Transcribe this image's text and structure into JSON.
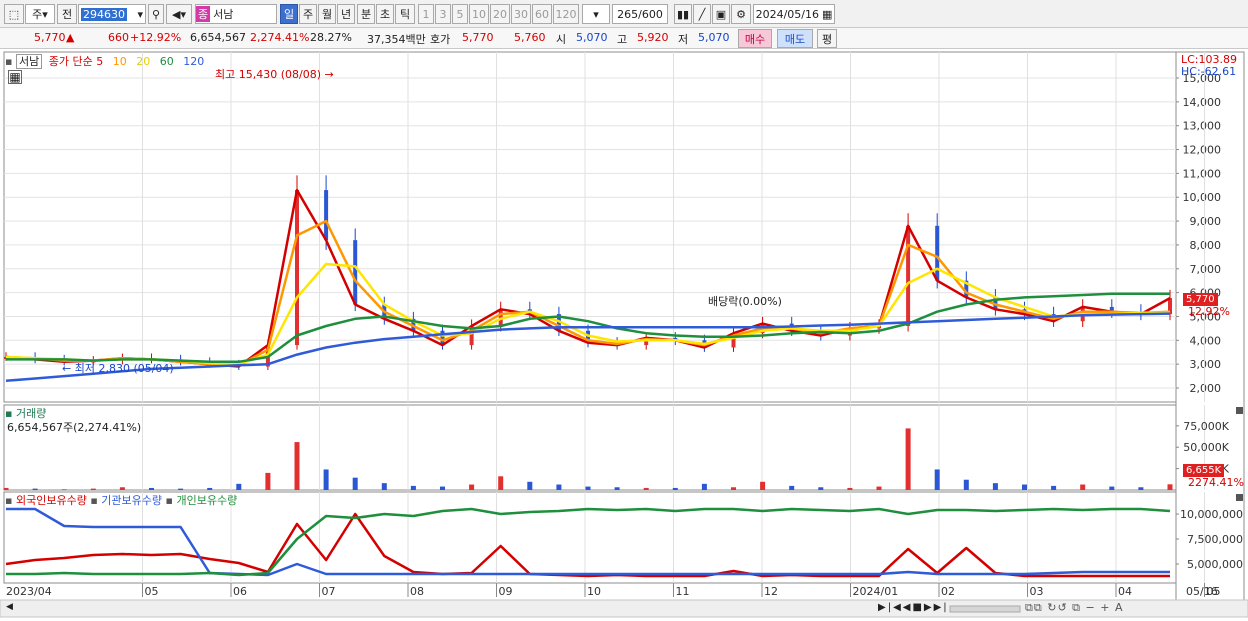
{
  "toolbar": {
    "market": "주",
    "prev": "전",
    "code": "294630",
    "stock_flag": "종",
    "stock_name": "서남",
    "periods": [
      "일",
      "주",
      "월",
      "년",
      "분",
      "초",
      "틱"
    ],
    "active_period": "일",
    "intervals": [
      "1",
      "3",
      "5",
      "10",
      "20",
      "30",
      "60",
      "120"
    ],
    "count": "265",
    "count_total": "/600",
    "date": "2024/05/16"
  },
  "quote": {
    "price": "5,770",
    "change_sign": "▲",
    "change": "660",
    "change_pct": "+12.92%",
    "volume": "6,654,567",
    "volume_ratio": "2,274.41%",
    "turnover": "28.27%",
    "amount": "37,354백만",
    "hoga_label": "호가",
    "ask": "5,770",
    "bid": "5,760",
    "open_label": "시",
    "open": "5,070",
    "high_label": "고",
    "high": "5,920",
    "low_label": "저",
    "low": "5,070",
    "buy_label": "매수",
    "sell_label": "매도",
    "eval_label": "평"
  },
  "price_panel": {
    "name_tag": "서남",
    "ma_title": "종가 단순",
    "ma_periods": [
      "5",
      "10",
      "20",
      "60",
      "120"
    ],
    "ma_colors": [
      "#d40000",
      "#ff9800",
      "#ffe600",
      "#1e8f3c",
      "#2f5bd8"
    ],
    "high_note": "최고 15,430 (08/08)",
    "low_note": "최저 2,830 (05/04)",
    "dividend_note": "배당락(0.00%)",
    "lc": "LC:103.89",
    "hc": "HC:-62.61",
    "price_tag": "5,770",
    "pct_tag": "12.92%",
    "y_ticks": [
      "15,000",
      "14,000",
      "13,000",
      "12,000",
      "11,000",
      "10,000",
      "9,000",
      "8,000",
      "7,000",
      "6,000",
      "5,000",
      "4,000",
      "3,000",
      "2,000"
    ]
  },
  "volume_panel": {
    "title": "거래량",
    "value": "6,654,567주(2,274.41%)",
    "y_ticks": [
      "75,000K",
      "50,000K",
      "25,000K"
    ],
    "tag": "6,655K",
    "tag_pct": "2274.41%"
  },
  "holding_panel": {
    "series_labels": [
      "외국인보유수량",
      "기관보유수량",
      "개인보유수량"
    ],
    "colors": [
      "#d40000",
      "#2f5bd8",
      "#1e8f3c"
    ],
    "y_ticks": [
      "10,000,000",
      "7,500,000",
      "5,000,000"
    ]
  },
  "x_axis": {
    "labels": [
      "2023/04",
      "05",
      "06",
      "07",
      "08",
      "09",
      "10",
      "11",
      "12",
      "2024/01",
      "02",
      "03",
      "04",
      "05"
    ],
    "right_label": "05/16"
  },
  "chart_data": {
    "type": "line",
    "title": "",
    "y_range": [
      2000,
      15430
    ],
    "series": [
      {
        "name": "5",
        "values": [
          3300,
          3200,
          3100,
          3150,
          3250,
          3200,
          3100,
          3000,
          2900,
          3800,
          10300,
          8200,
          5500,
          4900,
          4400,
          3800,
          4600,
          5300,
          5100,
          4400,
          3900,
          3800,
          4100,
          4000,
          3700,
          4300,
          4700,
          4400,
          4200,
          4500,
          4600,
          8800,
          6500,
          5800,
          5300,
          5100,
          4800,
          5400,
          5200,
          5100,
          5770
        ]
      },
      {
        "name": "10",
        "values": [
          3300,
          3250,
          3150,
          3150,
          3250,
          3200,
          3100,
          3000,
          2950,
          3600,
          8400,
          9000,
          6500,
          5200,
          4600,
          4000,
          4400,
          5100,
          5200,
          4600,
          4000,
          3850,
          4050,
          4000,
          3800,
          4200,
          4500,
          4500,
          4300,
          4500,
          4600,
          8000,
          7500,
          6000,
          5500,
          5200,
          4900,
          5200,
          5200,
          5150,
          5200
        ]
      },
      {
        "name": "20",
        "values": [
          3300,
          3250,
          3200,
          3150,
          3200,
          3200,
          3150,
          3050,
          3000,
          3400,
          5800,
          7200,
          7100,
          5500,
          4800,
          4200,
          4300,
          4900,
          5200,
          4800,
          4200,
          3950,
          4000,
          4000,
          3850,
          4100,
          4400,
          4500,
          4400,
          4400,
          4600,
          6400,
          7000,
          6400,
          5800,
          5400,
          5000,
          5100,
          5100,
          5150,
          5150
        ]
      },
      {
        "name": "60",
        "values": [
          3200,
          3200,
          3200,
          3150,
          3200,
          3200,
          3150,
          3100,
          3100,
          3300,
          4200,
          4600,
          4900,
          5000,
          4800,
          4600,
          4500,
          4600,
          4900,
          5000,
          4800,
          4500,
          4300,
          4200,
          4150,
          4150,
          4200,
          4300,
          4350,
          4300,
          4400,
          4700,
          5200,
          5500,
          5700,
          5800,
          5850,
          5900,
          5950,
          5950,
          5950
        ]
      },
      {
        "name": "120",
        "values": [
          2300,
          2400,
          2500,
          2600,
          2700,
          2800,
          2850,
          2900,
          2950,
          3000,
          3400,
          3700,
          3900,
          4050,
          4150,
          4250,
          4350,
          4450,
          4500,
          4550,
          4550,
          4550,
          4550,
          4550,
          4550,
          4550,
          4550,
          4580,
          4620,
          4650,
          4700,
          4750,
          4800,
          4850,
          4900,
          4950,
          5000,
          5050,
          5080,
          5100,
          5120
        ]
      }
    ],
    "volume_k": [
      3,
      2,
      1,
      2,
      4,
      3,
      2,
      3,
      9,
      25,
      70,
      30,
      18,
      10,
      6,
      5,
      8,
      20,
      12,
      8,
      5,
      4,
      3,
      3,
      9,
      4,
      12,
      6,
      4,
      3,
      5,
      90,
      30,
      15,
      10,
      8,
      6,
      8,
      5,
      4,
      6655
    ],
    "holdings": {
      "foreign": [
        5000000,
        5400000,
        5600000,
        5900000,
        6000000,
        5900000,
        6000000,
        5500000,
        5100000,
        4200000,
        9000000,
        5400000,
        10000000,
        5800000,
        4200000,
        4000000,
        4100000,
        6800000,
        4000000,
        3900000,
        3800000,
        3900000,
        3800000,
        3800000,
        3800000,
        4300000,
        3800000,
        3900000,
        3800000,
        3800000,
        3800000,
        6500000,
        4100000,
        6600000,
        4100000,
        3800000,
        3800000,
        3800000,
        3800000,
        3800000,
        3800000
      ],
      "institution": [
        10500000,
        10500000,
        8800000,
        8700000,
        8700000,
        8700000,
        8700000,
        4100000,
        4000000,
        3900000,
        5000000,
        4000000,
        4000000,
        4000000,
        4000000,
        4000000,
        4000000,
        4000000,
        4000000,
        4000000,
        4000000,
        4000000,
        4000000,
        4000000,
        4000000,
        4000000,
        4000000,
        4000000,
        4000000,
        4000000,
        4000000,
        4200000,
        4000000,
        4000000,
        4000000,
        4000000,
        4100000,
        4200000,
        4200000,
        4200000,
        4200000
      ],
      "individual": [
        4000000,
        4000000,
        4100000,
        4000000,
        4000000,
        4000000,
        4000000,
        4100000,
        3900000,
        4100000,
        7500000,
        9800000,
        9600000,
        10000000,
        9800000,
        10300000,
        10500000,
        10000000,
        10200000,
        10300000,
        10500000,
        10400000,
        10500000,
        10300000,
        10500000,
        10500000,
        10300000,
        10500000,
        10400000,
        10300000,
        10500000,
        10000000,
        10400000,
        10400000,
        10300000,
        10400000,
        10500000,
        10400000,
        10500000,
        10500000,
        10300000
      ]
    }
  }
}
